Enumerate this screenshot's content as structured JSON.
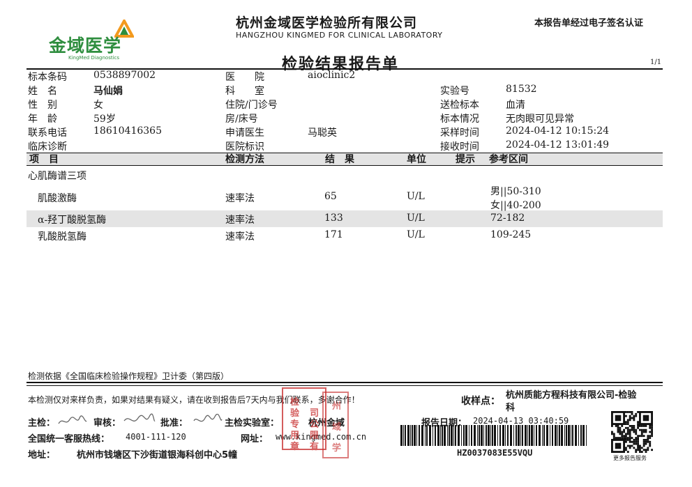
{
  "header": {
    "logo_text": "金域医学",
    "logo_sub": "KingMed Diagnostics",
    "lab_name_cn": "杭州金域医学检验所有限公司",
    "lab_name_en": "HANGZHOU KINGMED FOR CLINICAL LABORATORY",
    "certification": "本报告单经过电子签名认证",
    "title": "检验结果报告单",
    "page": "1/1"
  },
  "labels": {
    "barcode": "标本条码",
    "name": "姓　名",
    "gender": "性　别",
    "age": "年　龄",
    "phone": "联系电话",
    "diagnosis": "临床诊断",
    "hospital": "医　　院",
    "department": "科　　室",
    "inpatient": "住院/门诊号",
    "bed": "房/床号",
    "doctor": "申请医生",
    "hospital_id": "医院标识",
    "lab_no": "实验号",
    "sample": "送检标本",
    "sample_status": "标本情况",
    "collect_time": "采样时间",
    "receive_time": "接收时间"
  },
  "patient": {
    "barcode": "0538897002",
    "name": "马仙娟",
    "gender": "女",
    "age": "59岁",
    "phone": "18610416365",
    "hospital": "aioclinic2",
    "doctor": "马聪英",
    "lab_no": "81532",
    "sample": "血清",
    "sample_status": "无肉眼可见异常",
    "collect_time": "2024-04-12  10:15:24",
    "receive_time": "2024-04-12  13:01:49"
  },
  "columns": {
    "item": "项　目",
    "method": "检测方法",
    "result": "结　果",
    "unit": "单位",
    "hint": "提示",
    "ref": "参考区间"
  },
  "group": "心肌酶谱三项",
  "rows": [
    {
      "item": "肌酸激酶",
      "method": "速率法",
      "result": "65",
      "unit": "U/L",
      "ref1": "男||50-310",
      "ref2": "女||40-200"
    },
    {
      "item": "α-羟丁酸脱氢酶",
      "method": "速率法",
      "result": "133",
      "unit": "U/L",
      "ref1": "72-182"
    },
    {
      "item": "乳酸脱氢酶",
      "method": "速率法",
      "result": "171",
      "unit": "U/L",
      "ref1": "109-245"
    }
  ],
  "footer": {
    "basis": "检测依据《全国临床检验操作规程》卫计委（第四版）",
    "disclaimer": "本检测仅对来样负责，如果对结果有疑义，请在收到报告后7天内与我们联系，多谢合作！",
    "receiver_label": "收样点：",
    "receiver_line1": "杭州质能方程科技有限公司-检验",
    "receiver_line2": "科",
    "tester_label": "主检：",
    "reviewer_label": "审核：",
    "approver_label": "批准：",
    "lab_label": "主检实验室：",
    "lab_value": "杭州金域",
    "hotline_label": "全国统一客服热线：",
    "hotline": "4001-111-120",
    "website_label": "网址：",
    "website": "www.kingmed.com.cn",
    "address_label": "地址：",
    "address": "杭州市钱塘区下沙街道银海科创中心5幢",
    "report_date_label": "报告日期：",
    "report_date": "2024-04-13  03:40:59",
    "report_code": "HZ0037083E55VQU",
    "qr_caption": "更多报告服务",
    "stamp_chars": [
      "检",
      "验",
      "专",
      "用",
      "章",
      "司",
      "公",
      "限",
      "有"
    ],
    "stamp2_chars": [
      "州",
      "域",
      "学"
    ]
  },
  "colors": {
    "brand_green": "#2f8e3f",
    "stamp_red": "#c62828",
    "header_gray": "#e4e4e4"
  }
}
